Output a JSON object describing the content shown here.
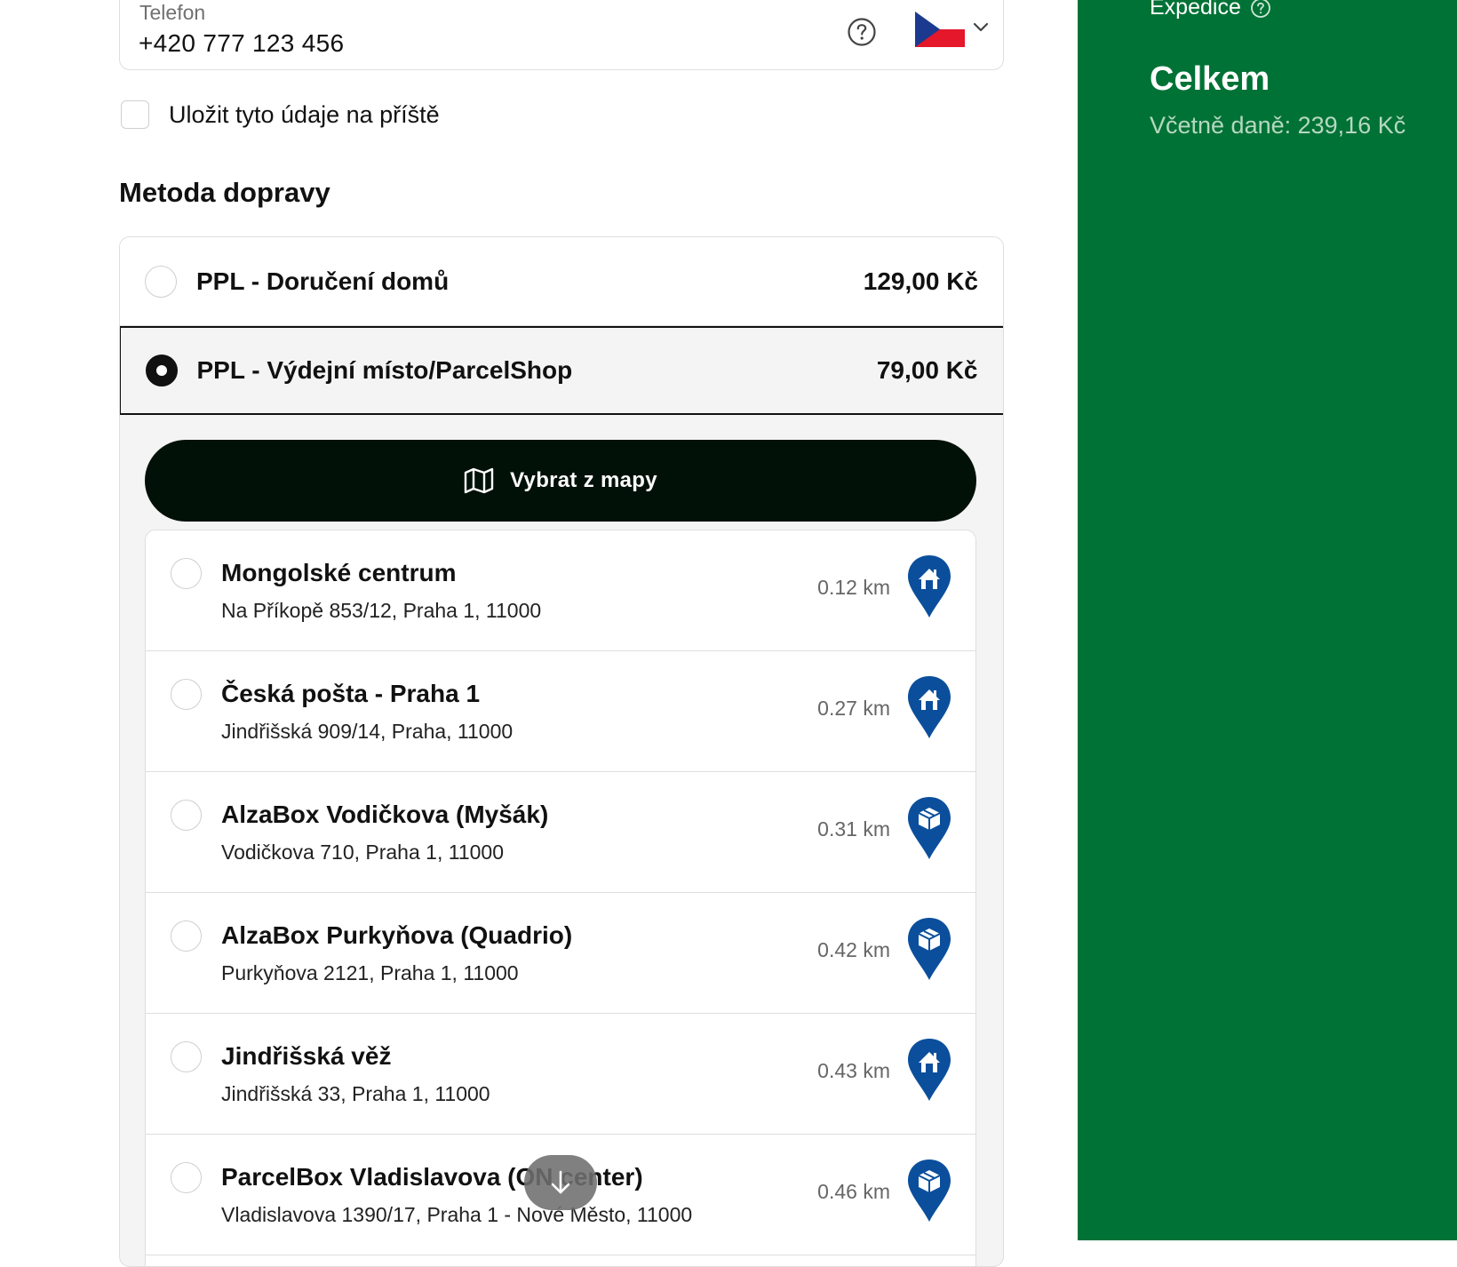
{
  "phone": {
    "label": "Telefon",
    "value": "+420 777 123 456",
    "help_icon": "question-circle-icon",
    "country_flag": "czech-flag-icon"
  },
  "save_details": {
    "label": "Uložit tyto údaje na příště",
    "checked": false
  },
  "shipping": {
    "title": "Metoda dopravy",
    "options": [
      {
        "name": "PPL - Doručení domů",
        "price": "129,00 Kč",
        "selected": false
      },
      {
        "name": "PPL - Výdejní místo/ParcelShop",
        "price": "79,00 Kč",
        "selected": true
      }
    ],
    "map_button": "Vybrat z mapy",
    "points": [
      {
        "name": "Mongolské centrum",
        "address": "Na Příkopě 853/12, Praha 1, 11000",
        "distance": "0.12 km",
        "icon": "home-pin-icon"
      },
      {
        "name": "Česká pošta - Praha 1",
        "address": "Jindřišská 909/14, Praha, 11000",
        "distance": "0.27 km",
        "icon": "home-pin-icon"
      },
      {
        "name": "AlzaBox Vodičkova (Myšák)",
        "address": "Vodičkova 710, Praha 1, 11000",
        "distance": "0.31 km",
        "icon": "box-pin-icon"
      },
      {
        "name": "AlzaBox Purkyňova (Quadrio)",
        "address": "Purkyňova 2121, Praha 1, 11000",
        "distance": "0.42 km",
        "icon": "box-pin-icon"
      },
      {
        "name": "Jindřišská věž",
        "address": "Jindřišská 33, Praha 1, 11000",
        "distance": "0.43 km",
        "icon": "home-pin-icon"
      },
      {
        "name": "ParcelBox Vladislavova (ON center)",
        "address": "Vladislavova 1390/17, Praha 1 - Nové Město, 11000",
        "distance": "0.46 km",
        "icon": "box-pin-icon"
      }
    ]
  },
  "sidebar": {
    "expedice": "Expedice",
    "total_label": "Celkem",
    "tax_text": "Včetně daně: 239,16 Kč"
  },
  "colors": {
    "sidebar_bg": "#007236",
    "pin_blue": "#0b4f9c",
    "button_dark": "#021108"
  }
}
